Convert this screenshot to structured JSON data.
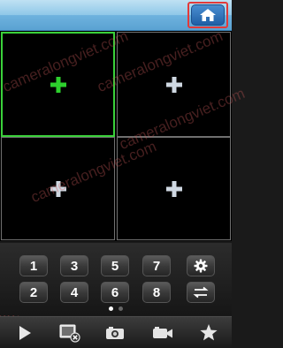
{
  "watermark_text": "cameralongviet.com",
  "header": {
    "home_icon": "home-icon"
  },
  "grid": {
    "cells": [
      {
        "icon": "plus-icon",
        "selected": true
      },
      {
        "icon": "plus-icon",
        "selected": false
      },
      {
        "icon": "plus-icon",
        "selected": false
      },
      {
        "icon": "plus-icon",
        "selected": false
      }
    ]
  },
  "keypad": {
    "row1": [
      "1",
      "3",
      "5",
      "7"
    ],
    "row2": [
      "2",
      "4",
      "6",
      "8"
    ],
    "settings_icon": "gear-icon",
    "switch_icon": "swap-arrows-icon"
  },
  "pager": {
    "total": 2,
    "active": 1
  },
  "toolbar": {
    "icons": [
      "play-icon",
      "stop-record-icon",
      "camera-icon",
      "video-camera-icon",
      "star-icon"
    ]
  },
  "colors": {
    "selected_border": "#3ad13a",
    "header_bg": "#8fc8e8",
    "highlight_border": "#e23a3a"
  }
}
